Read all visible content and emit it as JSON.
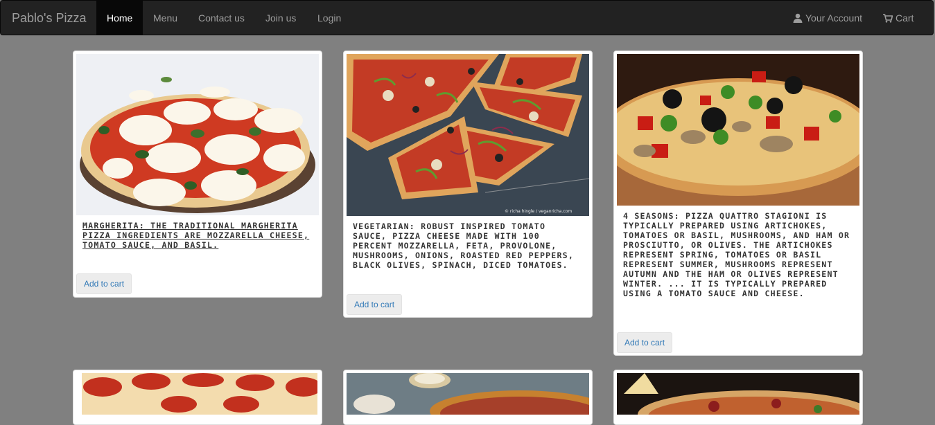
{
  "navbar": {
    "brand": "Pablo's Pizza",
    "items": [
      {
        "label": "Home"
      },
      {
        "label": "Menu"
      },
      {
        "label": "Contact us"
      },
      {
        "label": "Join us"
      },
      {
        "label": "Login"
      }
    ],
    "account_label": "Your Account",
    "cart_label": "Cart"
  },
  "cards": [
    {
      "caption": "Margherita: The traditional Margherita pizza ingredients are mozzarella cheese, tomato sauce, and basil.",
      "button": "Add to cart"
    },
    {
      "caption": "Vegetarian: Robust inspired tomato sauce, pizza cheese made with 100 percent mozzarella, feta, provolone, mushrooms, onions, roasted red peppers, black olives, spinach, diced tomatoes.",
      "button": "Add to cart",
      "watermark": "© richa hingle / veganricha.com"
    },
    {
      "caption": "4 Seasons: Pizza Quattro Stagioni is typically prepared using artichokes, tomatoes or basil, mushrooms, and ham or prosciutto, or olives. The artichokes represent spring, tomatoes or basil represent summer, mushrooms represent autumn and the ham or olives represent winter. ... It is typically prepared using a tomato sauce and cheese.",
      "button": "Add to cart"
    },
    {
      "caption": "",
      "button": ""
    },
    {
      "caption": "",
      "button": ""
    },
    {
      "caption": "",
      "button": ""
    }
  ],
  "colors": {
    "navbar_bg": "#222222",
    "page_bg": "#808080",
    "link": "#337ab7"
  },
  "icons": [
    "user-icon",
    "cart-icon"
  ]
}
